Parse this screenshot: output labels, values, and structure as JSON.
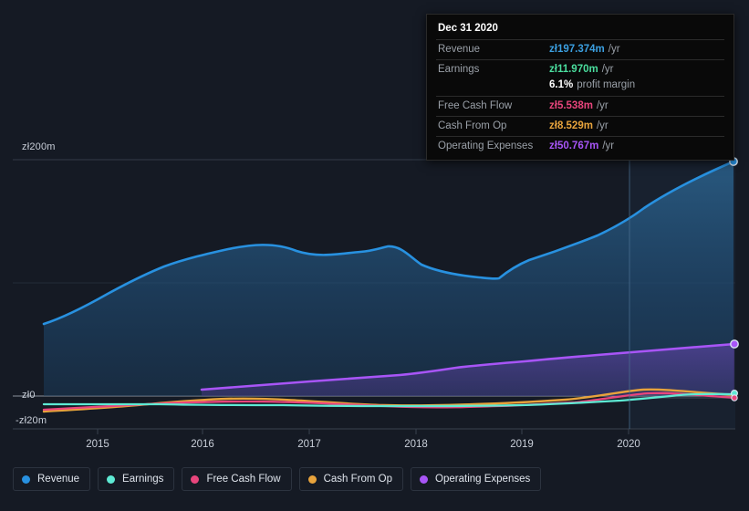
{
  "tooltip": {
    "date": "Dec 31 2020",
    "rows": [
      {
        "label": "Revenue",
        "value": "zł197.374m",
        "unit": "/yr",
        "color": "#3b9fe0"
      },
      {
        "label": "Earnings",
        "value": "zł11.970m",
        "unit": "/yr",
        "color": "#4ade9e"
      },
      {
        "label": "Free Cash Flow",
        "value": "zł5.538m",
        "unit": "/yr",
        "color": "#e8457c"
      },
      {
        "label": "Cash From Op",
        "value": "zł8.529m",
        "unit": "/yr",
        "color": "#e8a33c"
      },
      {
        "label": "Operating Expenses",
        "value": "zł50.767m",
        "unit": "/yr",
        "color": "#a855f7"
      }
    ],
    "profit_margin_value": "6.1%",
    "profit_margin_text": "profit margin"
  },
  "legend": {
    "items": [
      {
        "label": "Revenue",
        "color": "#2891e0"
      },
      {
        "label": "Earnings",
        "color": "#5eead4"
      },
      {
        "label": "Free Cash Flow",
        "color": "#e8457c"
      },
      {
        "label": "Cash From Op",
        "color": "#e8a33c"
      },
      {
        "label": "Operating Expenses",
        "color": "#a855f7"
      }
    ]
  },
  "chart_data": {
    "type": "area",
    "title": "",
    "xlabel": "",
    "ylabel": "",
    "ylim": [
      -20,
      200
    ],
    "y_ticks": [
      {
        "label": "zł200m",
        "value": 200
      },
      {
        "label": "zł0",
        "value": 0
      },
      {
        "label": "-zł20m",
        "value": -20
      }
    ],
    "x_ticks": [
      "2015",
      "2016",
      "2017",
      "2018",
      "2019",
      "2020"
    ],
    "grid": true,
    "legend_position": "bottom",
    "currency_prefix": "zł",
    "units": "m",
    "forecast_divider_x": "2020.6",
    "series": [
      {
        "name": "Revenue",
        "color": "#2891e0",
        "filled": true,
        "x": [
          2014.4,
          2014.8,
          2015.2,
          2015.6,
          2016.0,
          2016.4,
          2016.8,
          2017.2,
          2017.6,
          2017.9,
          2018.2,
          2018.6,
          2018.9,
          2019.2,
          2019.6,
          2020.0,
          2020.4,
          2020.8,
          2021.0
        ],
        "values": [
          65,
          75,
          86,
          97,
          106,
          113,
          120,
          126,
          132,
          136,
          133,
          127,
          122,
          128,
          133,
          142,
          155,
          178,
          197.374
        ]
      },
      {
        "name": "Operating Expenses",
        "color": "#a855f7",
        "filled": true,
        "x": [
          2016.0,
          2016.5,
          2017.0,
          2017.5,
          2018.0,
          2018.5,
          2019.0,
          2019.5,
          2020.0,
          2020.5,
          2021.0
        ],
        "values": [
          24,
          26,
          28,
          30,
          32,
          35,
          38,
          41,
          43,
          47,
          50.767
        ]
      },
      {
        "name": "Cash From Op",
        "color": "#e8a33c",
        "filled": false,
        "x": [
          2014.4,
          2015.0,
          2015.6,
          2016.2,
          2016.8,
          2017.4,
          2018.0,
          2018.6,
          2019.2,
          2019.8,
          2020.3,
          2020.7,
          2021.0
        ],
        "values": [
          -9,
          -6,
          -3,
          0,
          2,
          1,
          -1,
          0,
          1,
          3,
          7,
          9,
          8.529
        ]
      },
      {
        "name": "Free Cash Flow",
        "color": "#e8457c",
        "filled": false,
        "x": [
          2014.4,
          2015.0,
          2015.6,
          2016.2,
          2016.8,
          2017.4,
          2018.0,
          2018.6,
          2019.2,
          2019.8,
          2020.3,
          2020.7,
          2021.0
        ],
        "values": [
          -8,
          -5,
          -3,
          -1,
          1,
          0,
          -2,
          -2,
          -1,
          1,
          5,
          6,
          5.538
        ]
      },
      {
        "name": "Earnings",
        "color": "#5eead4",
        "filled": false,
        "x": [
          2014.4,
          2015.0,
          2015.6,
          2016.2,
          2016.8,
          2017.4,
          2018.0,
          2018.6,
          2019.2,
          2019.8,
          2020.3,
          2020.7,
          2021.0
        ],
        "values": [
          -1,
          -1,
          -1,
          -1,
          -2,
          -2,
          -2,
          -2,
          -1,
          0,
          2,
          6,
          11.97
        ]
      }
    ]
  }
}
